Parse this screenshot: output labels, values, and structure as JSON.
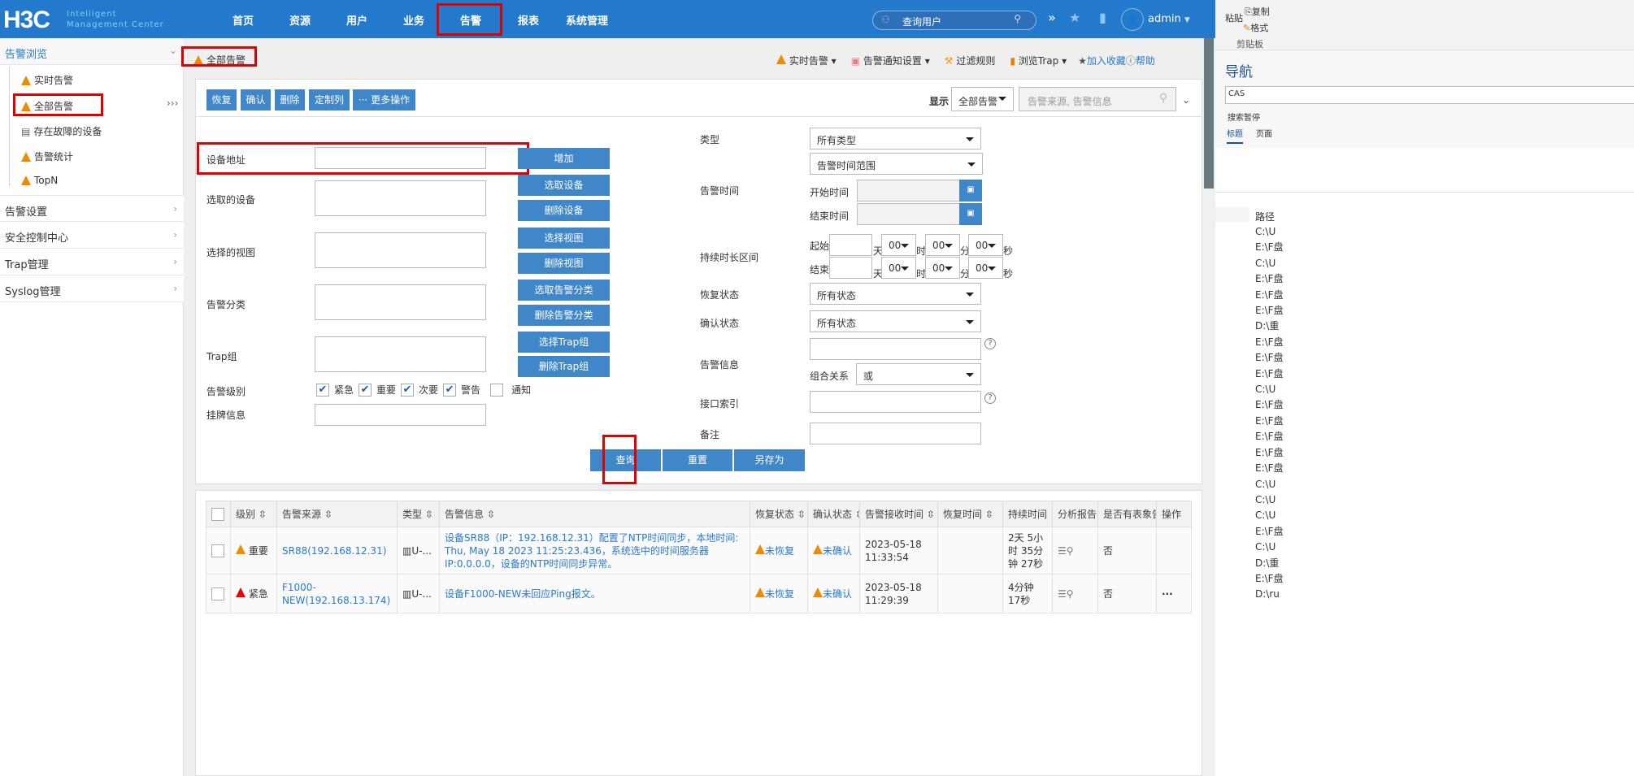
{
  "header": {
    "logo": "H3C",
    "logo_sub1": "Intelligent",
    "logo_sub2": "Management Center",
    "nav": [
      "首页",
      "资源",
      "用户",
      "业务",
      "告警",
      "报表",
      "系统管理"
    ],
    "active_nav": "告警",
    "search_placeholder": "查询用户",
    "user": "admin"
  },
  "sidebar": {
    "group": "告警浏览",
    "items": [
      "实时告警",
      "全部告警",
      "存在故障的设备",
      "告警统计",
      "TopN"
    ],
    "active": "全部告警",
    "sections": [
      "告警设置",
      "安全控制中心",
      "Trap管理",
      "Syslog管理"
    ],
    "collapse": "›››"
  },
  "breadcrumb": "全部告警",
  "toolbar_links": {
    "realtime": "实时告警",
    "notify": "告警通知设置",
    "filter": "过滤规则",
    "trap": "浏览Trap",
    "favorite": "加入收藏",
    "help": "帮助"
  },
  "actions": {
    "buttons": [
      "恢复",
      "确认",
      "删除",
      "定制列",
      "··· 更多操作"
    ],
    "show_label": "显示",
    "show_value": "全部告警",
    "search_placeholder": "告警来源, 告警信息"
  },
  "form": {
    "left": {
      "device_addr": "设备地址",
      "selected_devices": "选取的设备",
      "selected_views": "选择的视图",
      "category": "告警分类",
      "trap_group": "Trap组",
      "level": "告警级别",
      "tag_info": "挂牌信息",
      "levels": [
        {
          "label": "紧急",
          "checked": true
        },
        {
          "label": "重要",
          "checked": true
        },
        {
          "label": "次要",
          "checked": true
        },
        {
          "label": "警告",
          "checked": true
        },
        {
          "label": "通知",
          "checked": false
        }
      ]
    },
    "buttons": [
      "增加",
      "选取设备",
      "删除设备",
      "选择视图",
      "删除视图",
      "选取告警分类",
      "删除告警分类",
      "选择Trap组",
      "删除Trap组"
    ],
    "right": {
      "type_label": "类型",
      "type_value": "所有类型",
      "time_range": "告警时间范围",
      "alarm_time": "告警时间",
      "start_time": "开始时间",
      "end_time": "结束时间",
      "duration": "持续时长区间",
      "start": "起始",
      "end": "结束",
      "day": "天",
      "hour": "时",
      "minute": "分",
      "second": "秒",
      "zero": "00",
      "recover_label": "恢复状态",
      "recover_value": "所有状态",
      "ack_label": "确认状态",
      "ack_value": "所有状态",
      "info_label": "告警信息",
      "combine_label": "组合关系",
      "combine_value": "或",
      "ifindex_label": "接口索引",
      "remark_label": "备注"
    },
    "submit": [
      "查询",
      "重置",
      "另存为"
    ]
  },
  "table": {
    "headers": [
      "级别",
      "告警来源",
      "类型",
      "告警信息",
      "恢复状态",
      "确认状态",
      "告警接收时间",
      "恢复时间",
      "持续时间",
      "分析报告",
      "是否有表象告",
      "操作"
    ],
    "rows": [
      {
        "level": "重要",
        "level_color": "#f08a00",
        "source": "SR88(192.168.12.31)",
        "type": "U-...",
        "info": "设备SR88（IP：192.168.12.31）配置了NTP时间同步，本地时间: Thu, May 18 2023 11:25:23.436，系统选中的时间服务器IP:0.0.0.0，设备的NTP时间同步异常。",
        "recover": "未恢复",
        "ack": "未确认",
        "recv_time": "2023-05-18 11:33:54",
        "recover_time": "",
        "duration": "2天 5小时 35分钟 27秒",
        "has_symptom": "否",
        "op": ""
      },
      {
        "level": "紧急",
        "level_color": "#e00000",
        "source": "F1000-NEW(192.168.13.174)",
        "type": "U-...",
        "info": "设备F1000-NEW未回应Ping报文。",
        "recover": "未恢复",
        "ack": "未确认",
        "recv_time": "2023-05-18 11:29:39",
        "recover_time": "",
        "duration": "4分钟 17秒",
        "has_symptom": "否",
        "op": "···"
      }
    ]
  },
  "word_panel": {
    "paste": "粘贴",
    "copy": "复制",
    "format": "格式",
    "clipboard": "剪贴板",
    "nav_title": "导航",
    "search_value": "CAS",
    "search_pause": "搜索暂停",
    "tabs": [
      "标题",
      "页面"
    ],
    "path_header": "路径",
    "paths": [
      "C:\\U",
      "E:\\F盘",
      "C:\\U",
      "E:\\F盘",
      "E:\\F盘",
      "E:\\F盘",
      "D:\\重",
      "E:\\F盘",
      "E:\\F盘",
      "E:\\F盘",
      "C:\\U",
      "E:\\F盘",
      "E:\\F盘",
      "E:\\F盘",
      "E:\\F盘",
      "E:\\F盘",
      "C:\\U",
      "C:\\U",
      "C:\\U",
      "E:\\F盘",
      "C:\\U",
      "D:\\重",
      "E:\\F盘",
      "D:\\ru"
    ]
  }
}
